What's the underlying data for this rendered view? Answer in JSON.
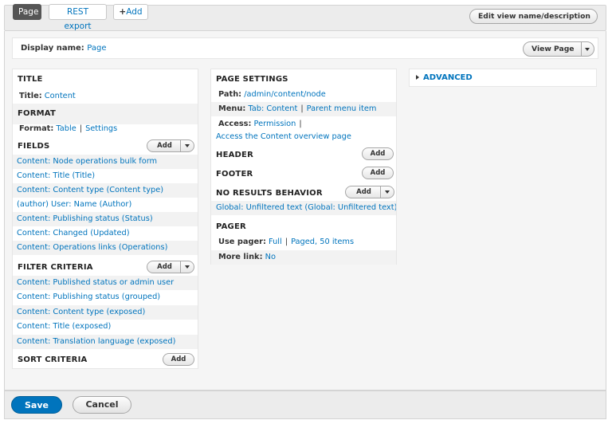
{
  "tabs": [
    {
      "label": "Page",
      "active": true
    },
    {
      "label": "REST export",
      "active": false
    },
    {
      "label": "Add"
    }
  ],
  "edit_view_button": "Edit view name/description",
  "display_name": {
    "label": "Display name:",
    "value": "Page"
  },
  "view_page_button": "View Page",
  "col1": {
    "title": {
      "heading": "TITLE",
      "label": "Title:",
      "value": "Content"
    },
    "format": {
      "heading": "FORMAT",
      "label": "Format:",
      "value": "Table",
      "settings": "Settings"
    },
    "fields": {
      "heading": "FIELDS",
      "add": "Add",
      "items": [
        "Content: Node operations bulk form",
        "Content: Title (Title)",
        "Content: Content type (Content type)",
        "(author) User: Name (Author)",
        "Content: Publishing status (Status)",
        "Content: Changed (Updated)",
        "Content: Operations links (Operations)"
      ]
    },
    "filter": {
      "heading": "FILTER CRITERIA",
      "add": "Add",
      "items": [
        "Content: Published status or admin user",
        "Content: Publishing status (grouped)",
        "Content: Content type (exposed)",
        "Content: Title (exposed)",
        "Content: Translation language (exposed)"
      ]
    },
    "sort": {
      "heading": "SORT CRITERIA",
      "add": "Add"
    }
  },
  "col2": {
    "page_settings": {
      "heading": "PAGE SETTINGS",
      "path_label": "Path:",
      "path_value": "/admin/content/node",
      "menu_label": "Menu:",
      "menu_value": "Tab: Content",
      "menu_parent": "Parent menu item",
      "access_label": "Access:",
      "access_value": "Permission",
      "access_link": "Access the Content overview page"
    },
    "header": {
      "heading": "HEADER",
      "add": "Add"
    },
    "footer": {
      "heading": "FOOTER",
      "add": "Add"
    },
    "no_results": {
      "heading": "NO RESULTS BEHAVIOR",
      "add": "Add",
      "item": "Global: Unfiltered text (Global: Unfiltered text)"
    },
    "pager": {
      "heading": "PAGER",
      "use_label": "Use pager:",
      "use_value": "Full",
      "use_paged": "Paged, 50 items",
      "more_label": "More link:",
      "more_value": "No"
    }
  },
  "col3": {
    "advanced": "ADVANCED"
  },
  "footer": {
    "save": "Save",
    "cancel": "Cancel"
  }
}
